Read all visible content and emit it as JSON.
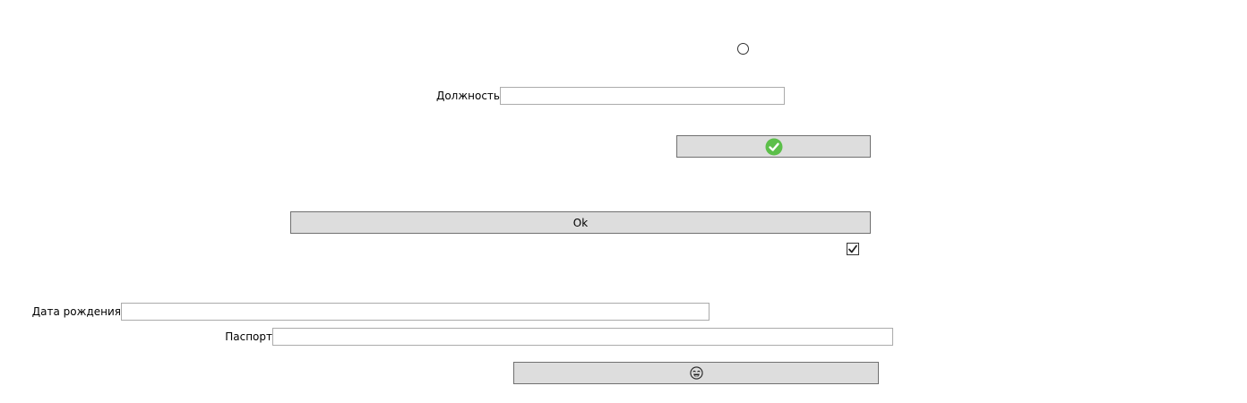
{
  "radio": {
    "checked": false
  },
  "position_field": {
    "label": "Должность",
    "value": ""
  },
  "confirm_button": {
    "icon": "check-circle-icon",
    "icon_color": "#5cbf4a"
  },
  "ok_button": {
    "label": "Ok"
  },
  "checkbox": {
    "checked": true
  },
  "birthdate_field": {
    "label": "Дата рождения",
    "value": ""
  },
  "passport_field": {
    "label": "Паспорт",
    "value": ""
  },
  "emoji_button": {
    "icon": "emoji-face-icon"
  },
  "colors": {
    "button_bg": "#dddddd",
    "button_border": "#707070",
    "textbox_border": "#ababab"
  }
}
